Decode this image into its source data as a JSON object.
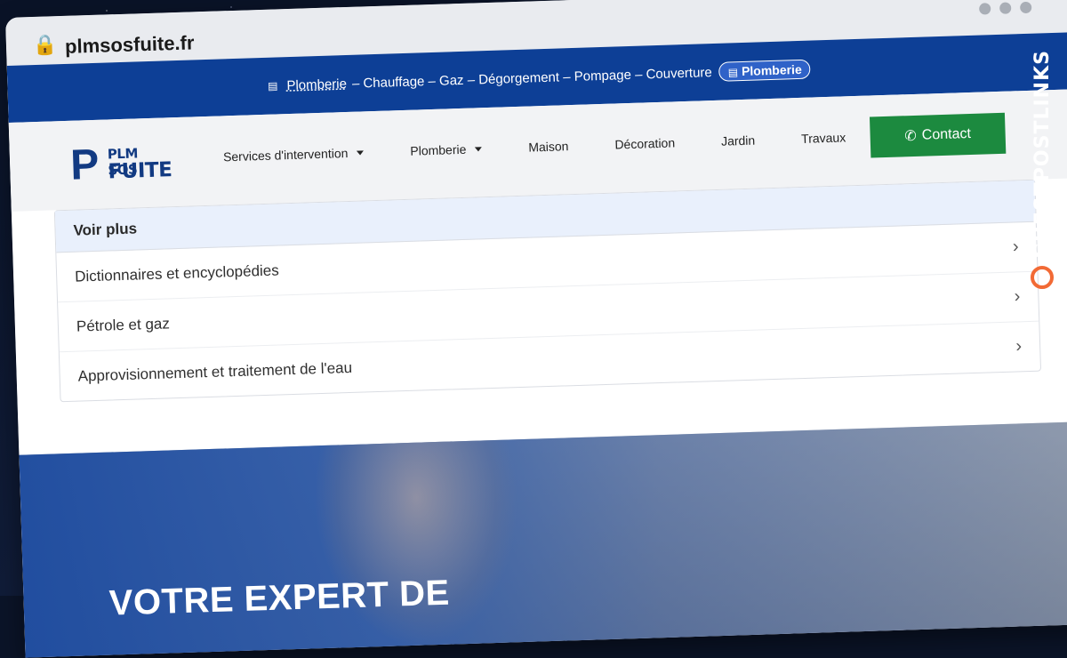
{
  "browser": {
    "url": "plmsosfuite.fr"
  },
  "topbar": {
    "items": [
      {
        "label": "Plomberie",
        "underlined": true
      },
      {
        "label": "– Chauffage – Gaz – Dégorgement – Pompage – Couverture"
      }
    ],
    "pill": "Plomberie"
  },
  "header": {
    "logo": {
      "line1": "PLM SOS",
      "line2": "FUITE"
    },
    "menu": [
      {
        "label": "Services d'intervention",
        "has_dropdown": true
      },
      {
        "label": "Plomberie",
        "has_dropdown": true
      },
      {
        "label": "Maison",
        "has_dropdown": false
      },
      {
        "label": "Décoration",
        "has_dropdown": false
      },
      {
        "label": "Jardin",
        "has_dropdown": false
      },
      {
        "label": "Travaux",
        "has_dropdown": false
      }
    ],
    "contact_label": "Contact"
  },
  "panel": {
    "title": "Voir plus",
    "items": [
      "Dictionnaires et encyclopédies",
      "Pétrole et gaz",
      "Approvisionnement et traitement de l'eau"
    ]
  },
  "hero": {
    "heading": "VOTRE EXPERT DE"
  },
  "side_brand": {
    "text": "GUESTPOSTLINKS"
  },
  "colors": {
    "topbar": "#0d3f96",
    "contact": "#1c8a3f",
    "brand_accent": "#f26a35"
  }
}
